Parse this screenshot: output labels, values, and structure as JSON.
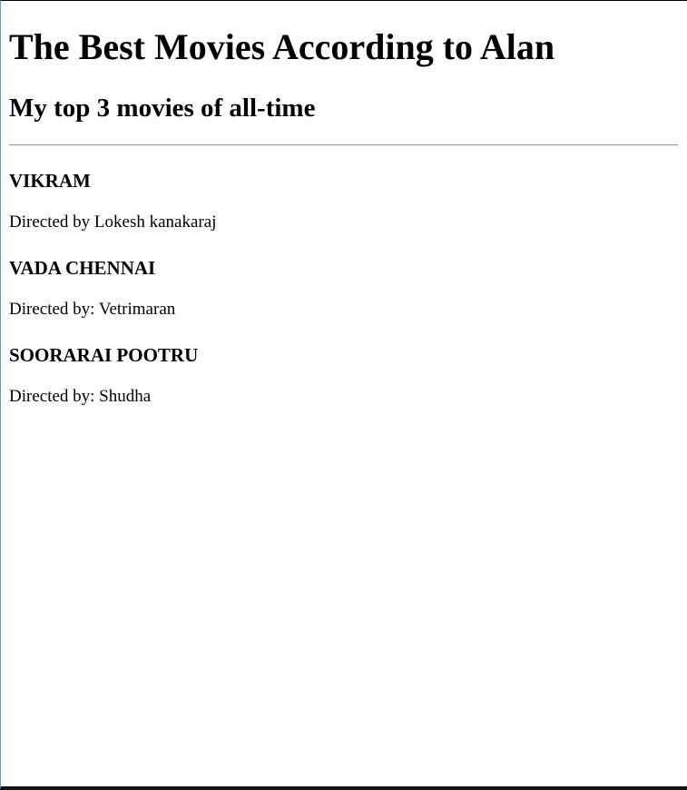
{
  "page": {
    "title": "The Best Movies According to Alan",
    "subtitle": "My top 3 movies of all-time"
  },
  "movies": [
    {
      "title": "VIKRAM",
      "director": "Directed by Lokesh kanakaraj"
    },
    {
      "title": "VADA CHENNAI",
      "director": "Directed by: Vetrimaran"
    },
    {
      "title": "SOORARAI POOTRU",
      "director": "Directed by: Shudha"
    }
  ]
}
